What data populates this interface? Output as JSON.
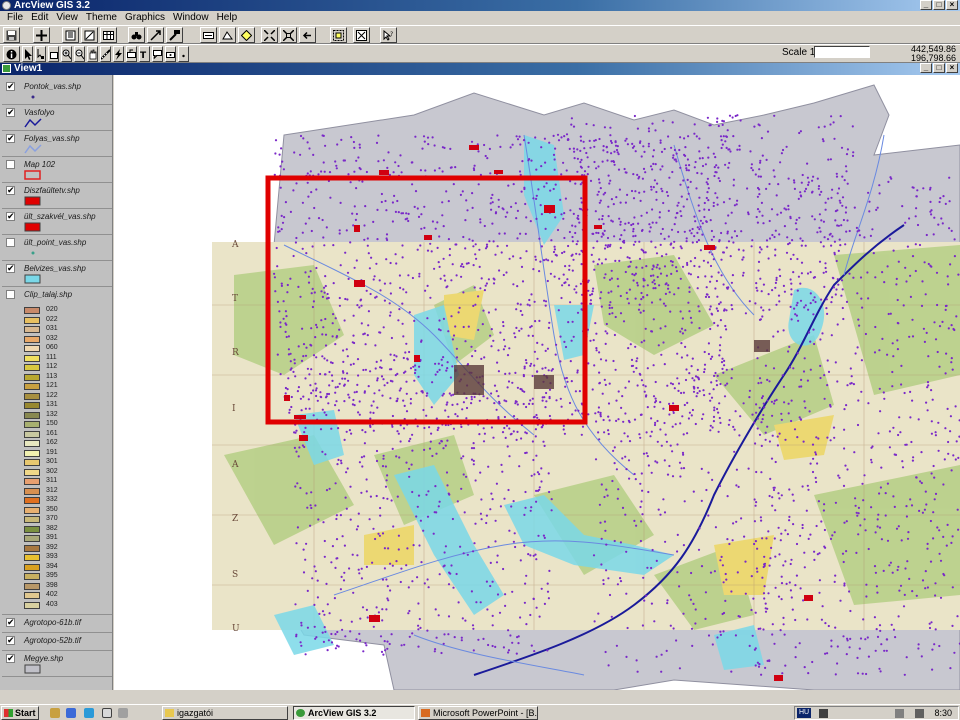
{
  "app": {
    "title": "ArcView GIS 3.2"
  },
  "menu": [
    "File",
    "Edit",
    "View",
    "Theme",
    "Graphics",
    "Window",
    "Help"
  ],
  "toolbar": {
    "scale_label": "Scale 1:",
    "scale_value": "",
    "coord_x": "442,549.86",
    "coord_y": "196,798.66"
  },
  "view": {
    "title": "View1"
  },
  "themes": [
    {
      "name": "Pontok_vas.shp",
      "checked": true,
      "symbol": "dot",
      "color": "#3a2a8a"
    },
    {
      "name": "Vasfolyo",
      "checked": true,
      "symbol": "line",
      "color": "#1a1a9a"
    },
    {
      "name": "Folyas_vas.shp",
      "checked": true,
      "symbol": "line",
      "color": "#8aa0e0"
    },
    {
      "name": "Map 102",
      "checked": false,
      "symbol": "rect-outline",
      "color": "#e02020"
    },
    {
      "name": "Diszfaültetv.shp",
      "checked": true,
      "symbol": "rect-fill",
      "color": "#e00000"
    },
    {
      "name": "ült_szakvél_vas.shp",
      "checked": true,
      "symbol": "rect-fill",
      "color": "#e00000"
    },
    {
      "name": "ült_point_vas.shp",
      "checked": false,
      "symbol": "dot",
      "color": "#3aa08a"
    },
    {
      "name": "Belvizes_vas.shp",
      "checked": true,
      "symbol": "rect-fill",
      "color": "#7ad8e8"
    },
    {
      "name": "Clip_talaj.shp",
      "checked": false,
      "symbol": "legend"
    },
    {
      "name": "Agrotopo-61b.tif",
      "checked": true,
      "symbol": "none"
    },
    {
      "name": "Agrotopo-52b.tif",
      "checked": true,
      "symbol": "none"
    },
    {
      "name": "Megye.shp",
      "checked": true,
      "symbol": "rect-fill",
      "color": "#c0c0c8"
    }
  ],
  "soil_legend": [
    {
      "code": "020",
      "color": "#c88a6a"
    },
    {
      "code": "022",
      "color": "#e8c060"
    },
    {
      "code": "031",
      "color": "#d8b890"
    },
    {
      "code": "032",
      "color": "#e8a868"
    },
    {
      "code": "060",
      "color": "#f0d8b0"
    },
    {
      "code": "111",
      "color": "#f0e060"
    },
    {
      "code": "112",
      "color": "#d8c840"
    },
    {
      "code": "113",
      "color": "#b8a830"
    },
    {
      "code": "121",
      "color": "#c8a040"
    },
    {
      "code": "122",
      "color": "#a89040"
    },
    {
      "code": "131",
      "color": "#988830"
    },
    {
      "code": "132",
      "color": "#888850"
    },
    {
      "code": "150",
      "color": "#a8b070"
    },
    {
      "code": "161",
      "color": "#c8c8a0"
    },
    {
      "code": "162",
      "color": "#e8e8c0"
    },
    {
      "code": "191",
      "color": "#f0f0b0"
    },
    {
      "code": "301",
      "color": "#e8c870"
    },
    {
      "code": "302",
      "color": "#f0d888"
    },
    {
      "code": "311",
      "color": "#e8a070"
    },
    {
      "code": "312",
      "color": "#d89050"
    },
    {
      "code": "332",
      "color": "#e07020"
    },
    {
      "code": "350",
      "color": "#e8b070"
    },
    {
      "code": "370",
      "color": "#c8b878"
    },
    {
      "code": "382",
      "color": "#7a9040"
    },
    {
      "code": "391",
      "color": "#a8a878"
    },
    {
      "code": "392",
      "color": "#a87840"
    },
    {
      "code": "393",
      "color": "#e8c030"
    },
    {
      "code": "394",
      "color": "#d8a020"
    },
    {
      "code": "395",
      "color": "#c8b060"
    },
    {
      "code": "398",
      "color": "#b89868"
    },
    {
      "code": "402",
      "color": "#e0c890"
    },
    {
      "code": "403",
      "color": "#d8d0a0"
    }
  ],
  "taskbar": {
    "start_label": "Start",
    "tasks": [
      "igazgatói",
      "ArcView GIS 3.2",
      "Microsoft PowerPoint - [B..."
    ],
    "lang": "HU",
    "clock": "8:30"
  },
  "map_labels": [
    "A",
    "T",
    "R",
    "I",
    "A",
    "Z",
    "S",
    "U"
  ]
}
